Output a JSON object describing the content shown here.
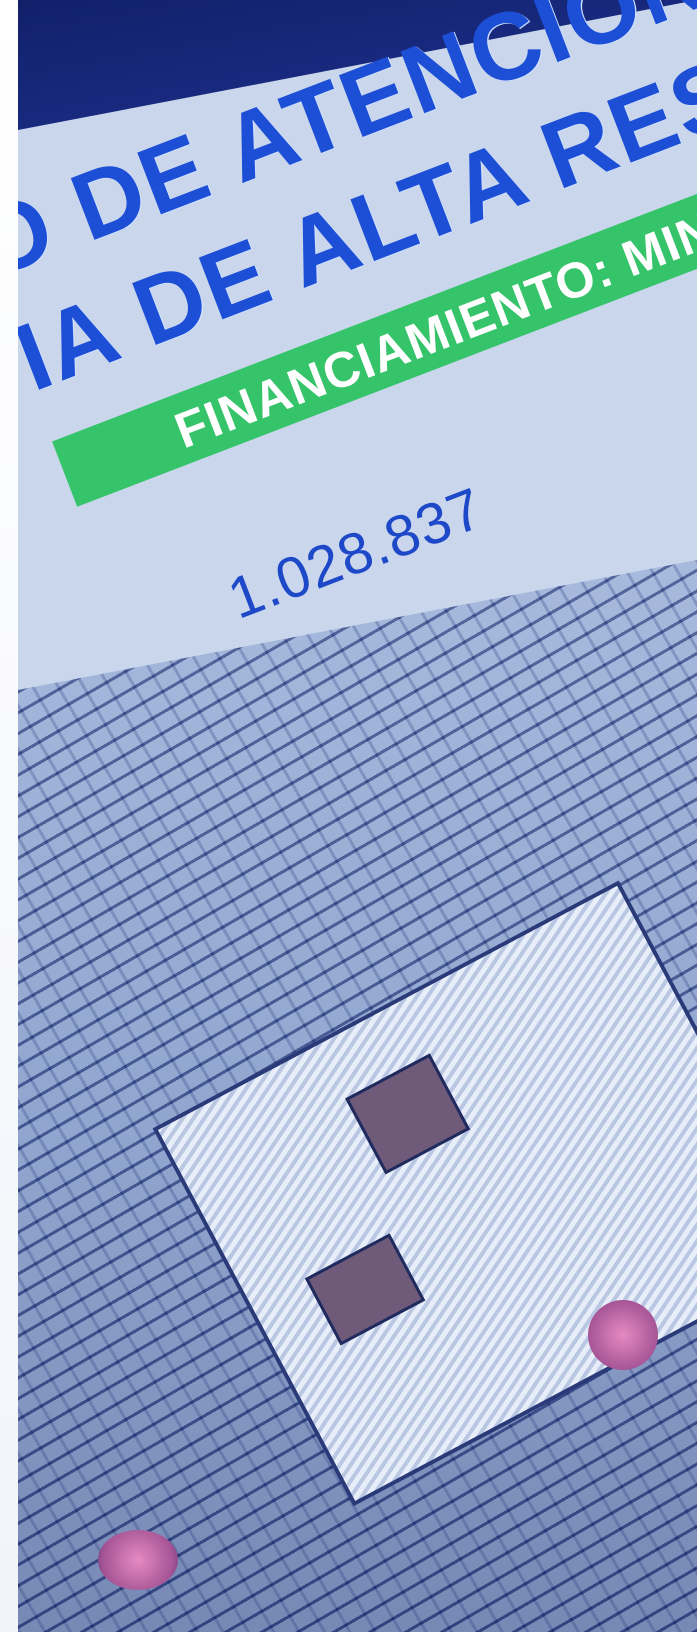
{
  "slide": {
    "headline_line1": "O DE ATENCIÓN P",
    "headline_line2": "IA DE ALTA RESO",
    "funding_label": "FINANCIAMIENTO: MINSAL.",
    "amount": "1.028.837"
  },
  "colors": {
    "headline": "#1d4fd6",
    "funding_bar": "#36c46a",
    "background": "#c9d6ec"
  }
}
